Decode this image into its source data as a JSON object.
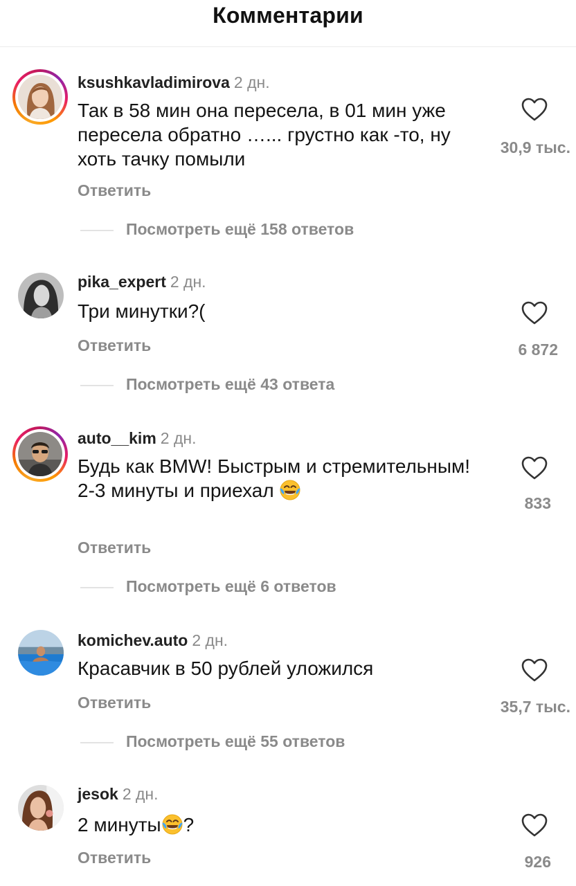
{
  "header": {
    "title": "Комментарии"
  },
  "comments": [
    {
      "username": "ksushkavladimirova",
      "time": "2 дн.",
      "text": "Так в 58 мин она пересела, в 01 мин уже пересела обратно …... грустно как -то, ну хоть тачку помыли",
      "reply_label": "Ответить",
      "likes": "30,9 тыс.",
      "view_more": "Посмотреть ещё 158 ответов"
    },
    {
      "username": "pika_expert",
      "time": "2 дн.",
      "text": "Три минутки?(",
      "reply_label": "Ответить",
      "likes": "6 872",
      "view_more": "Посмотреть ещё 43 ответа"
    },
    {
      "username": "auto__kim",
      "time": "2 дн.",
      "text": "Будь как BMW! Быстрым и стремительным! 2-3 минуты и приехал",
      "emoji": "face-with-tears-of-joy",
      "reply_label": "Ответить",
      "likes": "833",
      "view_more": "Посмотреть ещё 6 ответов"
    },
    {
      "username": "komichev.auto",
      "time": "2 дн.",
      "text": "Красавчик в 50 рублей уложился",
      "reply_label": "Ответить",
      "likes": "35,7 тыс.",
      "view_more": "Посмотреть ещё 55 ответов"
    },
    {
      "username": "jesok",
      "time": "2 дн.",
      "text_before": "2 минуты",
      "emoji": "face-with-tears-of-joy",
      "text_after": "?",
      "reply_label": "Ответить",
      "likes": "926"
    }
  ],
  "colors": {
    "muted": "#8a8a8a",
    "text": "#141414",
    "story_ring": "#e91e63"
  }
}
